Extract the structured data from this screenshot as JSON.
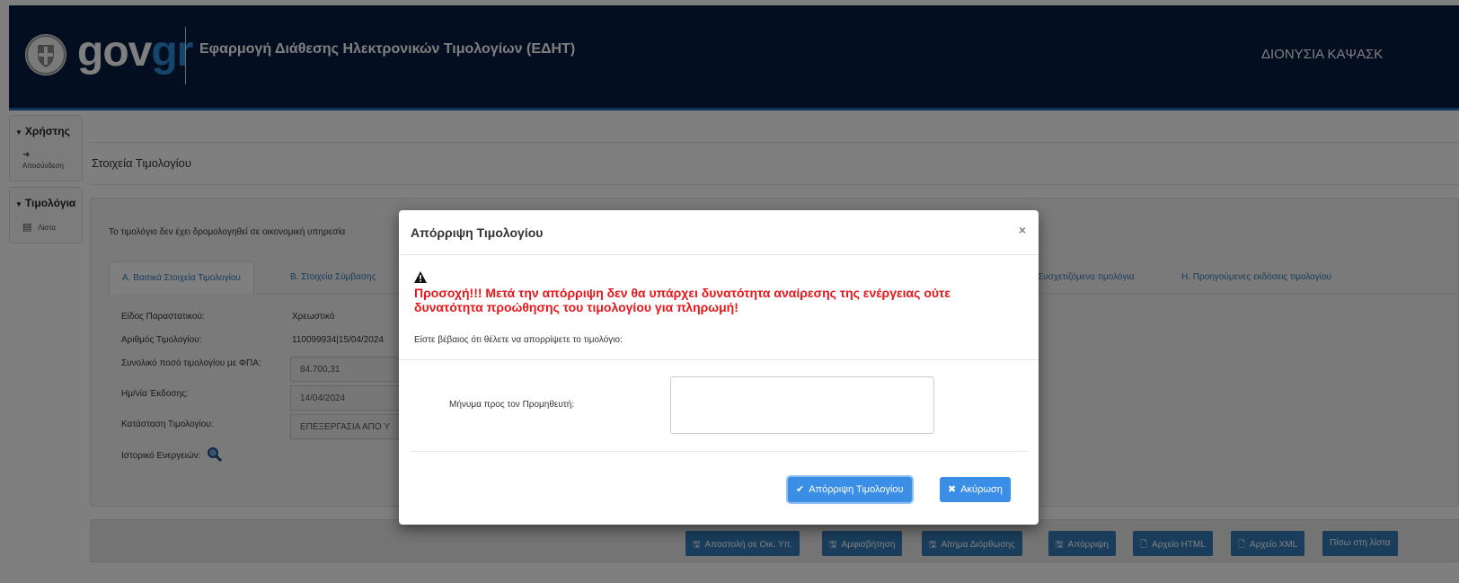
{
  "header": {
    "logo_gov": "gov",
    "logo_gr": "gr",
    "app_title": "Εφαρμογή Διάθεσης Ηλεκτρονικών Τιμολογίων (ΕΔΗΤ)",
    "user_name": "ΔΙΟΝΥΣΙΑ ΚΑΨΑΣΚ",
    "colors": {
      "background": "#071c40",
      "accent": "#1e6bb0",
      "logo_gr": "#2a8ad6"
    }
  },
  "sidebar": {
    "groups": [
      {
        "label": "Χρήστης",
        "items": [
          {
            "icon": "logout-icon",
            "label": "Αποσύνδεση"
          }
        ]
      },
      {
        "label": "Τιμολόγια",
        "items": [
          {
            "icon": "document-icon",
            "label": "Λίστα"
          }
        ]
      }
    ]
  },
  "main": {
    "page_title": "Στοιχεία Τιμολογίου",
    "notice": "Το τιμολόγιο δεν έχει δρομολογηθεί σε οικονομική υπηρεσία",
    "tabs": [
      {
        "label": "Α. Βασικά Στοιχεία Τιμολογίου",
        "active": true
      },
      {
        "label": "Β. Στοιχεία Σύμβασης",
        "active": false
      },
      {
        "label": "Συσχετιζόμενα τιμολόγια",
        "active": false
      },
      {
        "label": "Η. Προηγούμενες εκδόσεις τιμολογίου",
        "active": false
      }
    ],
    "fields": {
      "doc_type_label": "Είδος Παραστατικού:",
      "doc_type_value": "Χρεωστικό",
      "invoice_number_label": "Αριθμός Τιμολογίου:",
      "invoice_number_value": "110099934|15/04/2024",
      "total_label": "Συνολικό ποσό τιμολογίου με ΦΠΑ:",
      "total_value": "84.700,31",
      "issue_date_label": "Ημ/νία Έκδοσης:",
      "issue_date_value": "14/04/2024",
      "status_label": "Κατάσταση Τιμολογίου:",
      "status_value": "ΕΠΕΞΕΡΓΑΣΙΑ ΑΠΟ Υ",
      "history_label": "Ιστορικό Ενεργειών:"
    }
  },
  "footer_buttons": [
    {
      "icon": "save-icon",
      "label": "Αποστολή σε Οικ. Υπ."
    },
    {
      "icon": "save-icon",
      "label": "Αμφισβήτηση"
    },
    {
      "icon": "save-icon",
      "label": "Αίτημα Διόρθωσης"
    },
    {
      "icon": "save-icon",
      "label": "Απόρριψη"
    },
    {
      "icon": "file-icon",
      "label": "Αρχείο HTML"
    },
    {
      "icon": "file-icon",
      "label": "Αρχείο XML"
    },
    {
      "icon": "",
      "label": "Πίσω στη λίστα"
    }
  ],
  "modal": {
    "title": "Απόρριψη Τιμολογίου",
    "close": "×",
    "warning_line1": "Προσοχή!!! Μετά την απόρριψη δεν θα υπάρχει δυνατότητα αναίρεσης της ενέργειας ούτε",
    "warning_line2": "δυνατότητα προώθησης του τιμολογίου για πληρωμή!",
    "confirm_text": "Είστε βέβαιος ότι θέλετε να απορρίψετε το τιμολόγιο:",
    "message_label": "Μήνυμα προς τον Προμηθευτή:",
    "message_value": "",
    "reject_button": "Απόρριψη Τιμολογίου",
    "cancel_button": "Ακύρωση",
    "colors": {
      "warning": "#e8171b",
      "button": "#3a8ee6"
    }
  }
}
